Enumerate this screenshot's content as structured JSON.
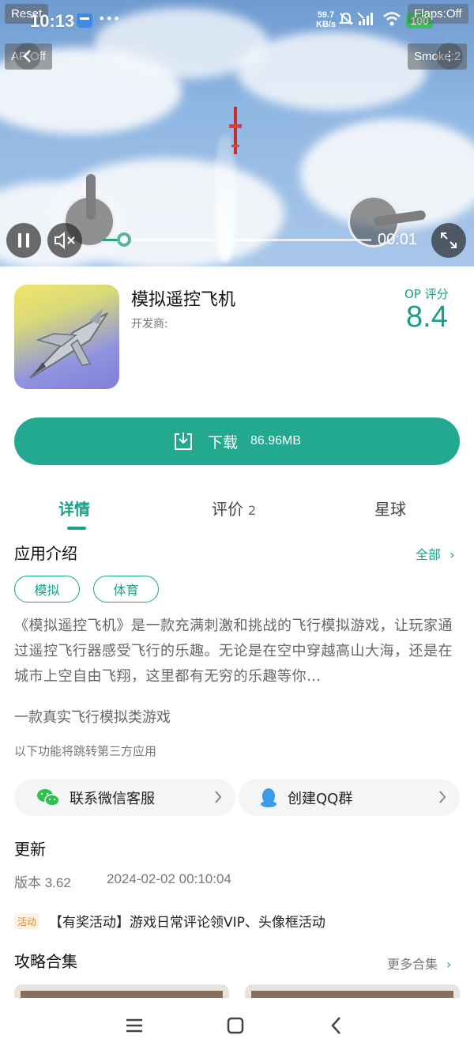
{
  "status_bar": {
    "time": "10:13",
    "network_speed_top": "59.7",
    "network_speed_unit": "KB/s",
    "battery": "100"
  },
  "game_overlay": {
    "reset_label": "Reset",
    "ap_label": "AP:Off",
    "flaps_label": "Flaps:Off",
    "smoke_label": "Smoke:2"
  },
  "player": {
    "timecode": "00:01",
    "progress_fraction": 0.08
  },
  "app": {
    "name": "模拟遥控飞机",
    "developer_label": "开发商:",
    "score_label": "OP 评分",
    "score": "8.4"
  },
  "download": {
    "label": "下载",
    "size": "86.96MB"
  },
  "tabs": [
    {
      "label": "详情",
      "count": ""
    },
    {
      "label": "评价",
      "count": "2"
    },
    {
      "label": "星球",
      "count": ""
    }
  ],
  "intro": {
    "title": "应用介绍",
    "all_link": "全部",
    "tags": [
      "模拟",
      "体育"
    ],
    "description": "《模拟遥控飞机》是一款充满刺激和挑战的飞行模拟游戏，让玩家通过遥控飞行器感受飞行的乐趣。无论是在空中穿越高山大海，还是在城市上空自由飞翔，这里都有无穷的乐趣等你…",
    "slogan": "一款真实飞行模拟类游戏",
    "third_party_note": "以下功能将跳转第三方应用"
  },
  "services": {
    "wechat_label": "联系微信客服",
    "qq_label": "创建QQ群"
  },
  "update": {
    "title": "更新",
    "version": "版本 3.62",
    "date": "2024-02-02 00:10:04",
    "activity_badge": "活动",
    "activity_text": "【有奖活动】游戏日常评论领VIP、头像框活动"
  },
  "guides": {
    "title": "攻略合集",
    "more_link": "更多合集"
  },
  "colors": {
    "accent": "#1aa088",
    "download_bg": "#23a98f"
  }
}
